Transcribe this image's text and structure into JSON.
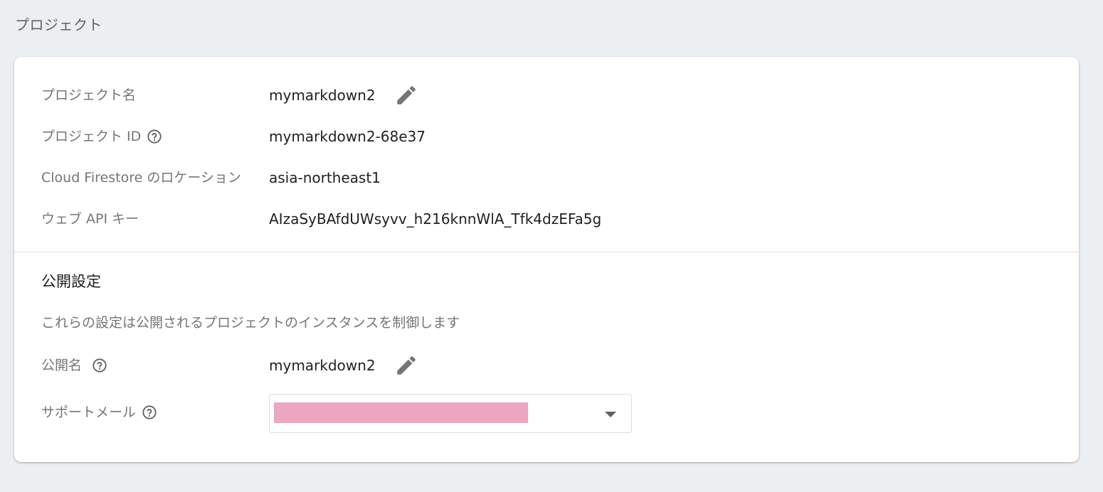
{
  "page": {
    "heading": "プロジェクト"
  },
  "project": {
    "rows": [
      {
        "label": "プロジェクト名",
        "value": "mymarkdown2"
      },
      {
        "label": "プロジェクト ID",
        "value": "mymarkdown2-68e37"
      },
      {
        "label": "Cloud Firestore のロケーション",
        "value": "asia-northeast1"
      },
      {
        "label": "ウェブ API キー",
        "value": "AIzaSyBAfdUWsyvv_h216knnWlA_Tfk4dzEFa5g"
      }
    ]
  },
  "public_settings": {
    "title": "公開設定",
    "description": "これらの設定は公開されるプロジェクトのインスタンスを制御します",
    "public_name": {
      "label": "公開名",
      "value": "mymarkdown2"
    },
    "support_email": {
      "label": "サポートメール",
      "value": ""
    }
  },
  "icons": {
    "edit": "pencil-icon",
    "help": "help-circle-icon",
    "dropdown": "arrow-drop-down-icon"
  },
  "colors": {
    "background": "#eceff1",
    "card": "#ffffff",
    "redaction": "#eba6c0",
    "icon": "#757575"
  }
}
